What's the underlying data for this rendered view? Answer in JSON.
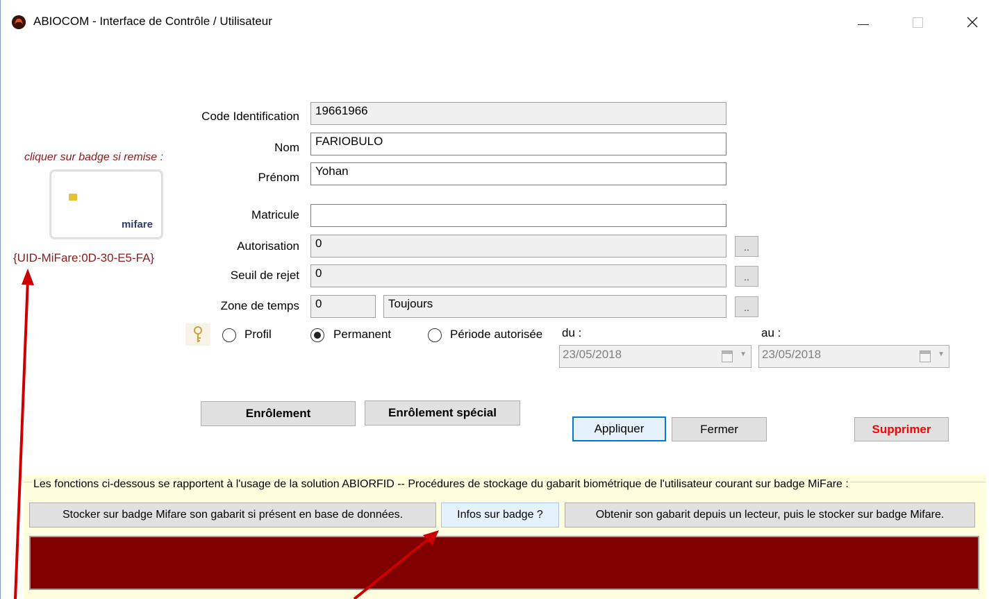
{
  "window": {
    "title": "ABIOCOM - Interface de Contrôle / Utilisateur",
    "controls": {
      "minimize": "minimize-icon",
      "maximize": "maximize-icon",
      "close": "close-icon"
    }
  },
  "badge": {
    "hint": "cliquer sur badge si remise :",
    "brand": "mifare",
    "uid": "{UID-MiFare:0D-30-E5-FA}"
  },
  "form": {
    "code": {
      "label": "Code Identification",
      "value": "19661966"
    },
    "nom": {
      "label": "Nom",
      "value": "FARIOBULO"
    },
    "prenom": {
      "label": "Prénom",
      "value": "Yohan"
    },
    "matricule": {
      "label": "Matricule",
      "value": ""
    },
    "autorisation": {
      "label": "Autorisation",
      "value": "0",
      "browse": ".."
    },
    "seuil": {
      "label": "Seuil de rejet",
      "value": "0",
      "browse": ".."
    },
    "zone": {
      "label": "Zone de temps",
      "value": "0",
      "name": "Toujours",
      "browse": ".."
    }
  },
  "access": {
    "options": [
      {
        "label": "Profil",
        "selected": false
      },
      {
        "label": "Permanent",
        "selected": true
      },
      {
        "label": "Période autorisée",
        "selected": false
      }
    ],
    "du": {
      "label": "du :",
      "value": "23/05/2018"
    },
    "au": {
      "label": "au :",
      "value": "23/05/2018"
    }
  },
  "buttons": {
    "enrolement": "Enrôlement",
    "enrolement_special": "Enrôlement spécial",
    "appliquer": "Appliquer",
    "fermer": "Fermer",
    "supprimer": "Supprimer"
  },
  "mifare_panel": {
    "description": "Les fonctions ci-dessous se rapportent à l'usage de la solution ABIORFID -- Procédures de stockage du gabarit biométrique de l'utilisateur courant sur badge MiFare :",
    "store_button": "Stocker sur badge Mifare son gabarit si présent en base de données.",
    "info_button": "Infos sur badge ?",
    "reader_button": "Obtenir son gabarit depuis un lecteur, puis le stocker sur badge Mifare."
  },
  "colors": {
    "accent_red": "#8b1a1a",
    "panel_background": "#ffffe0",
    "status_area": "#800000",
    "delete_text": "#ff0000",
    "default_button_border": "#0078d7"
  }
}
